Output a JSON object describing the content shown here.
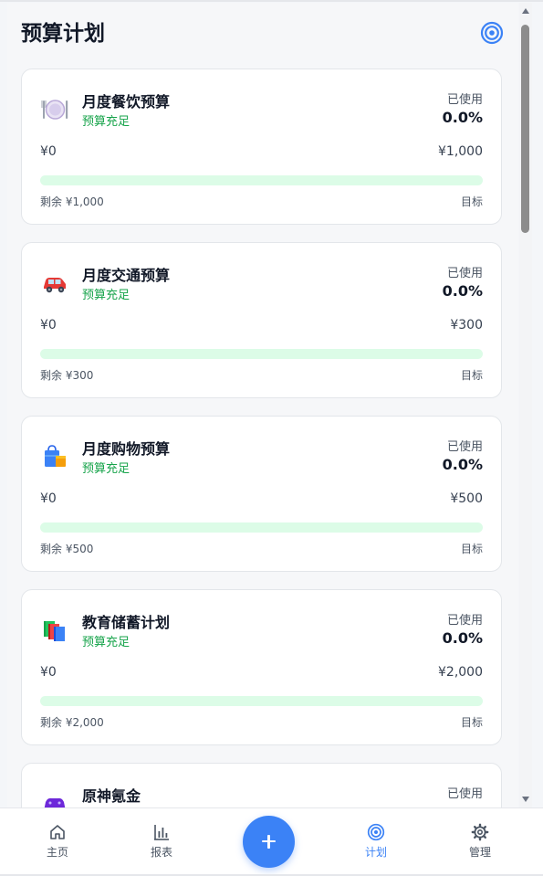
{
  "page": {
    "title": "预算计划"
  },
  "header": {
    "target_icon": "target-icon"
  },
  "cards": [
    {
      "name": "月度餐饮预算",
      "status": "预算充足",
      "used_label": "已使用",
      "used_pct": "0.0%",
      "spent": "¥0",
      "total": "¥1,000",
      "remaining": "剩余 ¥1,000",
      "goal": "目标",
      "progress": 0,
      "icon": "plate-icon"
    },
    {
      "name": "月度交通预算",
      "status": "预算充足",
      "used_label": "已使用",
      "used_pct": "0.0%",
      "spent": "¥0",
      "total": "¥300",
      "remaining": "剩余 ¥300",
      "goal": "目标",
      "progress": 0,
      "icon": "car-icon"
    },
    {
      "name": "月度购物预算",
      "status": "预算充足",
      "used_label": "已使用",
      "used_pct": "0.0%",
      "spent": "¥0",
      "total": "¥500",
      "remaining": "剩余 ¥500",
      "goal": "目标",
      "progress": 0,
      "icon": "shopping-bag-icon"
    },
    {
      "name": "教育储蓄计划",
      "status": "预算充足",
      "used_label": "已使用",
      "used_pct": "0.0%",
      "spent": "¥0",
      "total": "¥2,000",
      "remaining": "剩余 ¥2,000",
      "goal": "目标",
      "progress": 0,
      "icon": "books-icon"
    },
    {
      "name": "原神氪金",
      "used_label": "已使用",
      "icon": "gamepad-icon"
    }
  ],
  "tabbar": {
    "items": [
      {
        "label": "主页",
        "icon": "home-icon"
      },
      {
        "label": "报表",
        "icon": "bar-chart-icon"
      },
      {
        "label": "计划",
        "icon": "target-icon",
        "active": true
      },
      {
        "label": "管理",
        "icon": "gear-icon"
      }
    ],
    "add_button_icon": "plus-icon"
  },
  "colors": {
    "accent": "#3b82f6",
    "status_ok": "#16a34a",
    "bar_track": "#dcfce7"
  }
}
